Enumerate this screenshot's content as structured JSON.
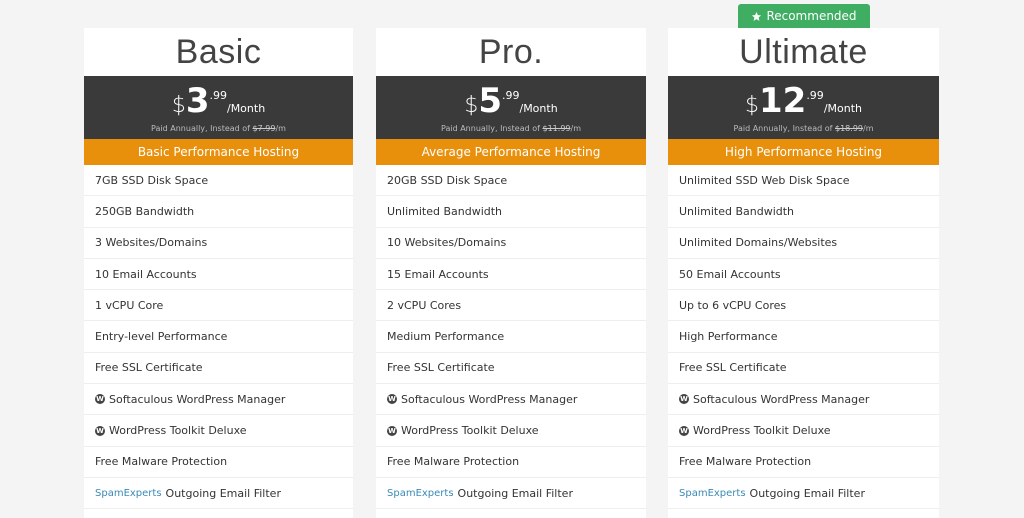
{
  "badge": {
    "label": "Recommended",
    "icon": "star-icon",
    "color": "#3fae63"
  },
  "colors": {
    "accent": "#e8900c",
    "band": "#3a3a3a",
    "background": "#f4f4f4"
  },
  "plans": [
    {
      "name": "Basic",
      "currency": "$",
      "price_int": "3",
      "price_cents": ".99",
      "period": "/Month",
      "paid_prefix": "Paid Annually, Instead of ",
      "old_price": "$7.99",
      "paid_suffix": "/m",
      "tagline": "Basic Performance Hosting",
      "features": [
        "7GB SSD Disk Space",
        "250GB Bandwidth",
        "3 Websites/Domains",
        "10 Email Accounts",
        "1 vCPU Core",
        "Entry-level Performance",
        "Free SSL Certificate",
        "Softaculous WordPress Manager",
        "WordPress Toolkit Deluxe",
        "Free Malware Protection",
        "Outgoing Email Filter"
      ]
    },
    {
      "name": "Pro.",
      "currency": "$",
      "price_int": "5",
      "price_cents": ".99",
      "period": "/Month",
      "paid_prefix": "Paid Annually, Instead of ",
      "old_price": "$11.99",
      "paid_suffix": "/m",
      "tagline": "Average Performance Hosting",
      "features": [
        "20GB SSD Disk Space",
        "Unlimited Bandwidth",
        "10 Websites/Domains",
        "15 Email Accounts",
        "2 vCPU Cores",
        "Medium Performance",
        "Free SSL Certificate",
        "Softaculous WordPress Manager",
        "WordPress Toolkit Deluxe",
        "Free Malware Protection",
        "Outgoing Email Filter"
      ]
    },
    {
      "name": "Ultimate",
      "currency": "$",
      "price_int": "12",
      "price_cents": ".99",
      "period": "/Month",
      "paid_prefix": "Paid Annually, Instead of ",
      "old_price": "$18.99",
      "paid_suffix": "/m",
      "tagline": "High Performance Hosting",
      "features": [
        "Unlimited SSD Web Disk Space",
        "Unlimited Bandwidth",
        "Unlimited Domains/Websites",
        "50 Email Accounts",
        "Up to 6 vCPU Cores",
        "High Performance",
        "Free SSL Certificate",
        "Softaculous WordPress Manager",
        "WordPress Toolkit Deluxe",
        "Free Malware Protection",
        "Outgoing Email Filter"
      ]
    }
  ],
  "spam_brand": "SpamExperts",
  "wp_icon": "wordpress-icon"
}
